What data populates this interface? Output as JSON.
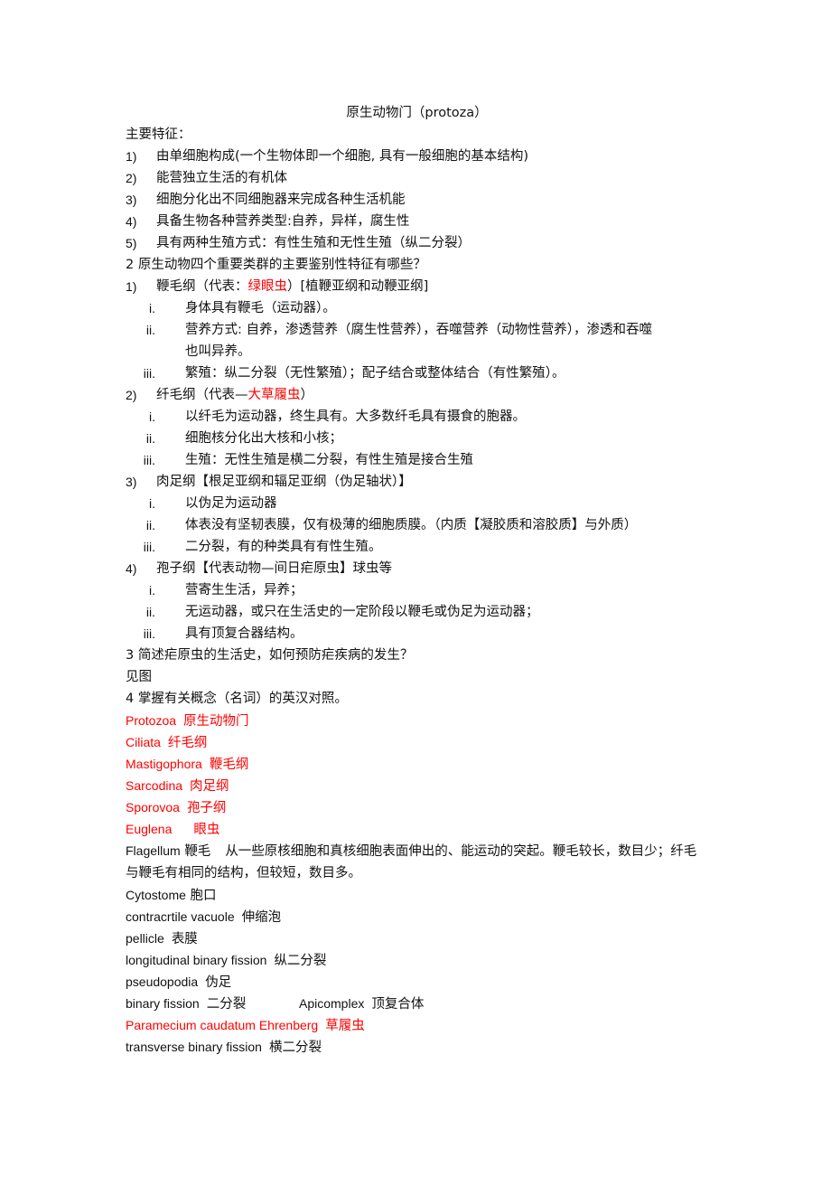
{
  "doc": {
    "title": "原生动物门（protoza）",
    "features_heading": "主要特征：",
    "features": [
      {
        "num": "1)",
        "text": "由单细胞构成(一个生物体即一个细胞, 具有一般细胞的基本结构)"
      },
      {
        "num": "2)",
        "text": "能营独立生活的有机体"
      },
      {
        "num": "3)",
        "text": "细胞分化出不同细胞器来完成各种生活机能"
      },
      {
        "num": "4)",
        "text": "具备生物各种营养类型:自养，异样，腐生性"
      },
      {
        "num": "5)",
        "text": "具有两种生殖方式：有性生殖和无性生殖（纵二分裂）"
      }
    ],
    "q2": "2  原生动物四个重要类群的主要鉴别性特征有哪些？",
    "groups": [
      {
        "num": "1)",
        "prefix": "鞭毛纲（代表：",
        "highlight": "绿眼虫",
        "suffix": "）[植鞭亚纲和动鞭亚纲]",
        "items": [
          {
            "num": "i.",
            "text": "身体具有鞭毛（运动器）。"
          },
          {
            "num": "ii.",
            "text": "营养方式: 自养，渗透营养（腐生性营养），吞噬营养（动物性营养），渗透和吞噬",
            "cont": "也叫异养。"
          },
          {
            "num": "iii.",
            "text": "繁殖：纵二分裂（无性繁殖）；配子结合或整体结合（有性繁殖）。"
          }
        ]
      },
      {
        "num": "2)",
        "prefix": "纤毛纲（代表—",
        "highlight": "大草履虫",
        "suffix": "）",
        "items": [
          {
            "num": "i.",
            "text": "以纤毛为运动器，终生具有。大多数纤毛具有摄食的胞器。"
          },
          {
            "num": "ii.",
            "text": "细胞核分化出大核和小核；"
          },
          {
            "num": "iii.",
            "text": "生殖：无性生殖是横二分裂，有性生殖是接合生殖"
          }
        ]
      },
      {
        "num": "3)",
        "prefix": "肉足纲【根足亚纲和辐足亚纲（伪足轴状）】",
        "highlight": "",
        "suffix": "",
        "items": [
          {
            "num": "i.",
            "text": "以伪足为运动器"
          },
          {
            "num": "ii.",
            "text": "体表没有坚韧表膜，仅有极薄的细胞质膜。（内质【凝胶质和溶胶质】与外质）"
          },
          {
            "num": "iii.",
            "text": "二分裂，有的种类具有有性生殖。"
          }
        ]
      },
      {
        "num": "4)",
        "prefix": "孢子纲【代表动物—间日疟原虫】球虫等",
        "highlight": "",
        "suffix": "",
        "items": [
          {
            "num": "i.",
            "text": "营寄生生活，异养；"
          },
          {
            "num": "ii.",
            "text": "无运动器，或只在生活史的一定阶段以鞭毛或伪足为运动器；"
          },
          {
            "num": "iii.",
            "text": "具有顶复合器结构。"
          }
        ]
      }
    ],
    "q3": "3  简述疟原虫的生活史，如何预防疟疾病的发生？",
    "q3_answer": "见图",
    "q4": "4  掌握有关概念（名词）的英汉对照。",
    "red_terms": [
      {
        "en": "Protozoa",
        "zh": "原生动物门"
      },
      {
        "en": "Ciliata",
        "zh": "纤毛纲"
      },
      {
        "en": "Mastigophora",
        "zh": "鞭毛纲"
      },
      {
        "en": "Sarcodina",
        "zh": "肉足纲"
      },
      {
        "en": "Sporovoa",
        "zh": "孢子纲"
      },
      {
        "en": "Euglena",
        "zh": "眼虫"
      }
    ],
    "flagellum": {
      "en": "Flagellum",
      "zh": "鞭毛",
      "definition": "从一些原核细胞和真核细胞表面伸出的、能运动的突起。鞭毛较长，数目少；纤毛与鞭毛有相同的结构，但较短，数目多。"
    },
    "terms": [
      {
        "en": "Cytostome",
        "zh": "胞口"
      },
      {
        "en": "contracrtile vacuole",
        "zh": "伸缩泡"
      },
      {
        "en": "pellicle",
        "zh": "表膜"
      },
      {
        "en": "longitudinal binary fission",
        "zh": "纵二分裂"
      },
      {
        "en": "pseudopodia",
        "zh": "伪足"
      }
    ],
    "binary_row": {
      "en": "binary fission",
      "zh": "二分裂",
      "en2": "Apicomplex",
      "zh2": "顶复合体"
    },
    "paramecium": {
      "en": "Paramecium caudatum Ehrenberg",
      "zh": "草履虫"
    },
    "transverse": {
      "en": "transverse binary fission",
      "zh": "横二分裂"
    },
    "colors": {
      "text": "#111111",
      "highlight": "#ff0000"
    }
  }
}
